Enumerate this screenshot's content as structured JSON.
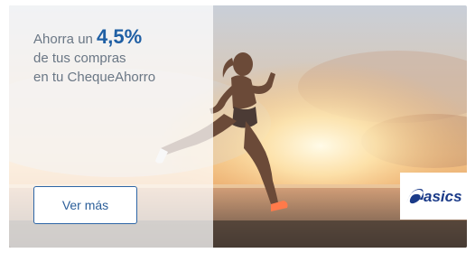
{
  "promo": {
    "line1_prefix": "Ahorra un",
    "line1_value": "4,5%",
    "line2": "de tus compras",
    "line3": "en tu ChequeAhorro"
  },
  "cta": {
    "label": "Ver más"
  },
  "brand": {
    "name": "asics"
  },
  "colors": {
    "accent": "#1f5fa4",
    "button_border": "#2e66a6",
    "brand_logo": "#1a3a88"
  }
}
